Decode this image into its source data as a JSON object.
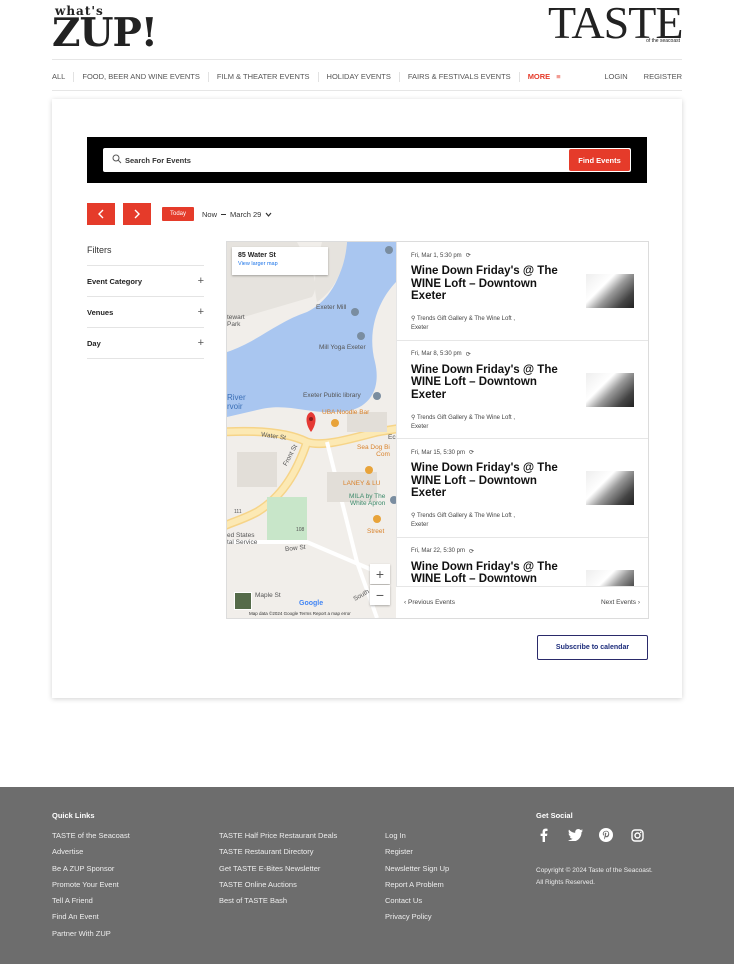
{
  "header": {
    "zup_small": "what's",
    "zup_big": "ZUP!",
    "taste_big": "TASTE",
    "taste_small": "of the seacoast"
  },
  "nav": {
    "items": [
      "ALL",
      "FOOD, BEER AND WINE EVENTS",
      "FILM & THEATER EVENTS",
      "HOLIDAY EVENTS",
      "FAIRS & FESTIVALS EVENTS"
    ],
    "more": "MORE",
    "login": "LOGIN",
    "register": "REGISTER"
  },
  "search": {
    "placeholder": "Search For Events",
    "button": "Find Events"
  },
  "date_nav": {
    "today": "Today",
    "from": "Now",
    "to": "March 29"
  },
  "filters": {
    "title": "Filters",
    "items": [
      "Event Category",
      "Venues",
      "Day"
    ]
  },
  "map": {
    "address": "85 Water St",
    "view_larger": "View larger map",
    "labels": {
      "exeter_mill": "Exeter Mill",
      "stewart_park": "tewart\nPark",
      "mill_yoga": "Mill Yoga Exeter",
      "river": "River\nrvoir",
      "library": "Exeter Public library",
      "uba": "UBA Noodle Bar",
      "water_st": "Water St",
      "front_st": "Front St",
      "sea_dog": "Sea Dog Bi\nCom",
      "laney": "LANEY & LU",
      "mila": "MILA by The\nWhite Apron",
      "street": "Street",
      "states": "ed States\ntal Service",
      "bow_st": "Bow St",
      "maple_st": "Maple St",
      "south": "South",
      "ec": "Ec",
      "r111": "111",
      "r108": "108"
    },
    "google": "Google",
    "footer": "Map data ©2024 Google   Terms   Report a map error"
  },
  "events": [
    {
      "date": "Fri, Mar 1, 5:30 pm",
      "title": "Wine Down Friday's @ The WINE Loft – Downtown Exeter",
      "venue_line1": "Trends Gift Gallery & The Wine Loft ,",
      "venue_line2": "Exeter"
    },
    {
      "date": "Fri, Mar 8, 5:30 pm",
      "title": "Wine Down Friday's @ The WINE Loft – Downtown Exeter",
      "venue_line1": "Trends Gift Gallery & The Wine Loft ,",
      "venue_line2": "Exeter"
    },
    {
      "date": "Fri, Mar 15, 5:30 pm",
      "title": "Wine Down Friday's @ The WINE Loft – Downtown Exeter",
      "venue_line1": "Trends Gift Gallery & The Wine Loft ,",
      "venue_line2": "Exeter"
    },
    {
      "date": "Fri, Mar 22, 5:30 pm",
      "title": "Wine Down Friday's @ The WINE Loft – Downtown",
      "venue_line1": "",
      "venue_line2": ""
    }
  ],
  "pager": {
    "prev": "Previous Events",
    "next": "Next Events"
  },
  "subscribe": "Subscribe to calendar",
  "footer": {
    "quick_links_title": "Quick Links",
    "col1": [
      "TASTE of the Seacoast",
      "Advertise",
      "Be A ZUP Sponsor",
      "Promote Your Event",
      "Tell A Friend",
      "Find An Event",
      "Partner With ZUP"
    ],
    "col2": [
      "TASTE Half Price Restaurant Deals",
      "TASTE Restaurant Directory",
      "Get TASTE E-Bites Newsletter",
      "TASTE Online Auctions",
      "Best of TASTE Bash"
    ],
    "col3": [
      "Log In",
      "Register",
      "Newsletter Sign Up",
      "Report A Problem",
      "Contact Us",
      "Privacy Policy"
    ],
    "social_title": "Get Social",
    "copyright_1": "Copyright © 2024 Taste of the Seacoast.",
    "copyright_2": "All Rights Reserved."
  },
  "colors": {
    "accent": "#e53b2a",
    "footer_bg": "#6d6d6d",
    "link_blue": "#1a73e8"
  }
}
